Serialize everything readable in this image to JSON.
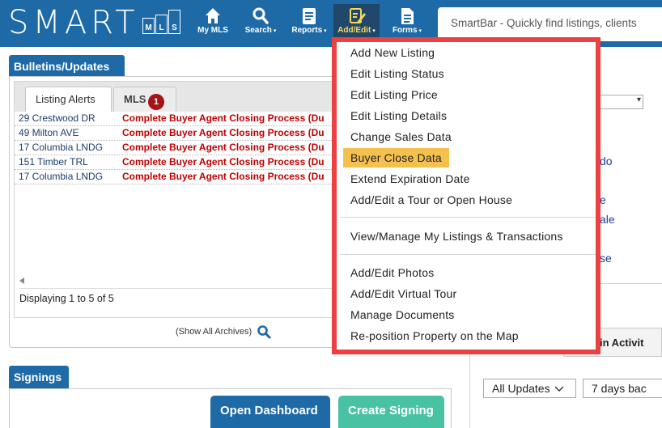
{
  "header": {
    "logo_text": "SMART",
    "logo_boxes": [
      "M",
      "L",
      "S"
    ],
    "nav": [
      {
        "label": "My MLS",
        "icon": "home-icon",
        "has_caret": false
      },
      {
        "label": "Search",
        "icon": "search-icon",
        "has_caret": true
      },
      {
        "label": "Reports",
        "icon": "reports-icon",
        "has_caret": true
      },
      {
        "label": "Add/Edit",
        "icon": "edit-icon",
        "has_caret": true,
        "active": true
      },
      {
        "label": "Forms",
        "icon": "document-icon",
        "has_caret": true
      }
    ],
    "caret": "▾",
    "smartbar_placeholder": "SmartBar - Quickly find listings, clients"
  },
  "bulletins": {
    "title": "Bulletins/Updates",
    "tabs": [
      {
        "label": "Listing Alerts",
        "active": true
      },
      {
        "label": "MLS",
        "badge": "1"
      }
    ],
    "rows": [
      {
        "address": "29 Crestwood DR",
        "message": "Complete Buyer Agent Closing Process (Du"
      },
      {
        "address": "49 Milton AVE",
        "message": "Complete Buyer Agent Closing Process (Du"
      },
      {
        "address": "17 Columbia LNDG",
        "message": "Complete Buyer Agent Closing Process (Du"
      },
      {
        "address": "151 Timber TRL",
        "message": "Complete Buyer Agent Closing Process (Du"
      },
      {
        "address": "17 Columbia LNDG",
        "message": "Complete Buyer Agent Closing Process (Du"
      }
    ],
    "display_count": "Displaying 1 to 5 of 5",
    "show_archives": "(Show All Archives)"
  },
  "signings": {
    "title": "Signings",
    "open_dashboard": "Open Dashboard",
    "create_signing": "Create Signing"
  },
  "right_panel": {
    "links": [
      "do",
      "e",
      "ale",
      "se"
    ],
    "activity_label": "in Activit",
    "updates_dropdown": "All Updates",
    "days_dropdown": "7 days bac"
  },
  "add_edit_menu": {
    "groups": [
      {
        "items": [
          {
            "label": "Add New Listing"
          },
          {
            "label": "Edit Listing Status"
          },
          {
            "label": "Edit Listing Price"
          },
          {
            "label": "Edit Listing Details"
          },
          {
            "label": "Change Sales Data"
          },
          {
            "label": "Buyer Close Data",
            "selected": true
          },
          {
            "label": "Extend Expiration Date"
          },
          {
            "label": "Add/Edit a Tour or Open House"
          }
        ]
      },
      {
        "items": [
          {
            "label": "View/Manage My Listings & Transactions"
          }
        ]
      },
      {
        "items": [
          {
            "label": "Add/Edit Photos"
          },
          {
            "label": "Add/Edit Virtual Tour"
          },
          {
            "label": "Manage Documents"
          },
          {
            "label": "Re-position Property on the Map"
          }
        ]
      }
    ],
    "highlight_color": "#ee4040",
    "selected_color": "#f5c14e"
  },
  "colors": {
    "brand_blue": "#1d6aa7",
    "nav_active": "#21476b",
    "alert_red": "#c10000",
    "badge_red": "#a51416",
    "create_green": "#49c2a4"
  }
}
